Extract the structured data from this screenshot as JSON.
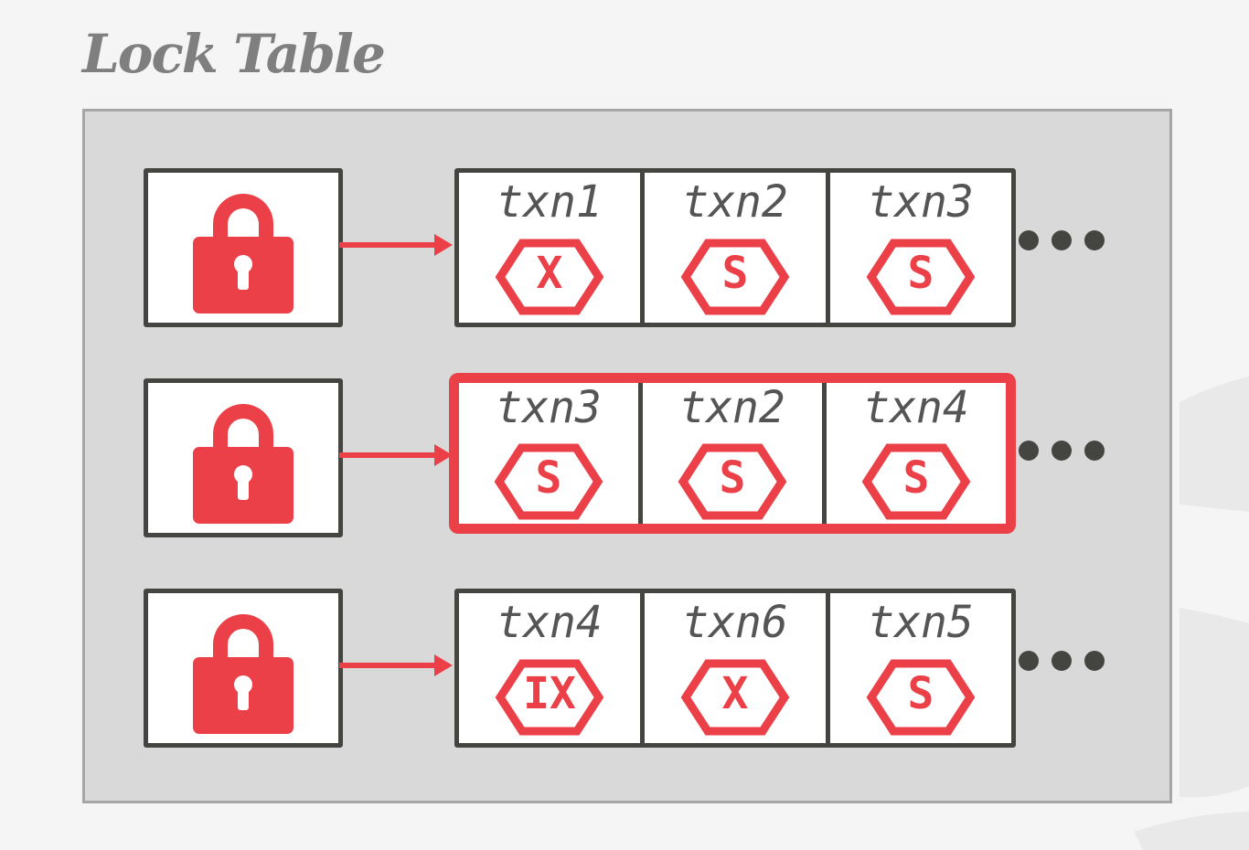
{
  "title": "Lock Table",
  "colors": {
    "accent": "#ec4048",
    "border": "#444440",
    "text": "#555555",
    "panel": "#d9d9d9",
    "title": "#7f7f7f"
  },
  "icons": {
    "lock": "lock-icon",
    "arrow": "arrow-right-icon",
    "badge": "hexagon-badge",
    "more": "ellipsis-icon"
  },
  "rows": [
    {
      "highlighted": false,
      "requests": [
        {
          "txn": "txn1",
          "mode": "X"
        },
        {
          "txn": "txn2",
          "mode": "S"
        },
        {
          "txn": "txn3",
          "mode": "S"
        }
      ]
    },
    {
      "highlighted": true,
      "requests": [
        {
          "txn": "txn3",
          "mode": "S"
        },
        {
          "txn": "txn2",
          "mode": "S"
        },
        {
          "txn": "txn4",
          "mode": "S"
        }
      ]
    },
    {
      "highlighted": false,
      "requests": [
        {
          "txn": "txn4",
          "mode": "IX"
        },
        {
          "txn": "txn6",
          "mode": "X"
        },
        {
          "txn": "txn5",
          "mode": "S"
        }
      ]
    }
  ]
}
